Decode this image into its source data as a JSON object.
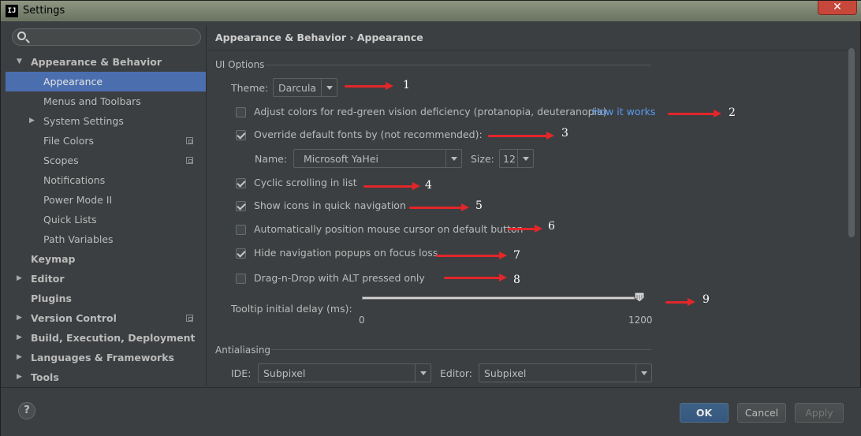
{
  "window": {
    "title": "Settings",
    "app_logo": "IJ",
    "close_glyph": "✕"
  },
  "search": {
    "placeholder": ""
  },
  "sidebar": {
    "items": [
      {
        "label": "Appearance & Behavior",
        "level": 0,
        "expanded": true,
        "bold": true
      },
      {
        "label": "Appearance",
        "level": 1,
        "selected": true
      },
      {
        "label": "Menus and Toolbars",
        "level": 1
      },
      {
        "label": "System Settings",
        "level": 1,
        "expandable": true
      },
      {
        "label": "File Colors",
        "level": 1,
        "project_icon": true
      },
      {
        "label": "Scopes",
        "level": 1,
        "project_icon": true
      },
      {
        "label": "Notifications",
        "level": 1
      },
      {
        "label": "Power Mode II",
        "level": 1
      },
      {
        "label": "Quick Lists",
        "level": 1
      },
      {
        "label": "Path Variables",
        "level": 1
      },
      {
        "label": "Keymap",
        "level": 0,
        "bold": true
      },
      {
        "label": "Editor",
        "level": 0,
        "expandable": true,
        "bold": true
      },
      {
        "label": "Plugins",
        "level": 0,
        "bold": true
      },
      {
        "label": "Version Control",
        "level": 0,
        "expandable": true,
        "bold": true,
        "project_icon": true
      },
      {
        "label": "Build, Execution, Deployment",
        "level": 0,
        "expandable": true,
        "bold": true
      },
      {
        "label": "Languages & Frameworks",
        "level": 0,
        "expandable": true,
        "bold": true
      },
      {
        "label": "Tools",
        "level": 0,
        "expandable": true,
        "bold": true
      }
    ]
  },
  "content": {
    "breadcrumb": "Appearance & Behavior › Appearance",
    "ui_options": {
      "title": "UI Options",
      "theme_label": "Theme:",
      "theme_value": "Darcula",
      "adjust_colors": {
        "label": "Adjust colors for red-green vision deficiency (protanopia, deuteranopia)",
        "checked": false
      },
      "how_it_works": "How it works",
      "override_fonts": {
        "label": "Override default fonts by (not recommended):",
        "checked": true
      },
      "font_name_label": "Name:",
      "font_name_value": "Microsoft YaHei",
      "font_size_label": "Size:",
      "font_size_value": "12",
      "cyclic_scrolling": {
        "label": "Cyclic scrolling in list",
        "checked": true
      },
      "show_icons": {
        "label": "Show icons in quick navigation",
        "checked": true
      },
      "auto_position_cursor": {
        "label": "Automatically position mouse cursor on default button",
        "checked": false
      },
      "hide_nav_popups": {
        "label": "Hide navigation popups on focus loss",
        "checked": true
      },
      "drag_n_drop": {
        "label": "Drag-n-Drop with ALT pressed only",
        "checked": false
      },
      "tooltip_label": "Tooltip initial delay (ms):",
      "tooltip_min": "0",
      "tooltip_max": "1200",
      "tooltip_value": 1200
    },
    "antialiasing": {
      "title": "Antialiasing",
      "ide_label": "IDE:",
      "ide_value": "Subpixel",
      "editor_label": "Editor:",
      "editor_value": "Subpixel"
    }
  },
  "annotations": [
    "1",
    "2",
    "3",
    "4",
    "5",
    "6",
    "7",
    "8",
    "9"
  ],
  "footer": {
    "help": "?",
    "ok": "OK",
    "cancel": "Cancel",
    "apply": "Apply"
  },
  "colors": {
    "accent": "#4b6eaf",
    "link": "#589df6",
    "annotation": "#e3262a",
    "background": "#3c3f41"
  }
}
